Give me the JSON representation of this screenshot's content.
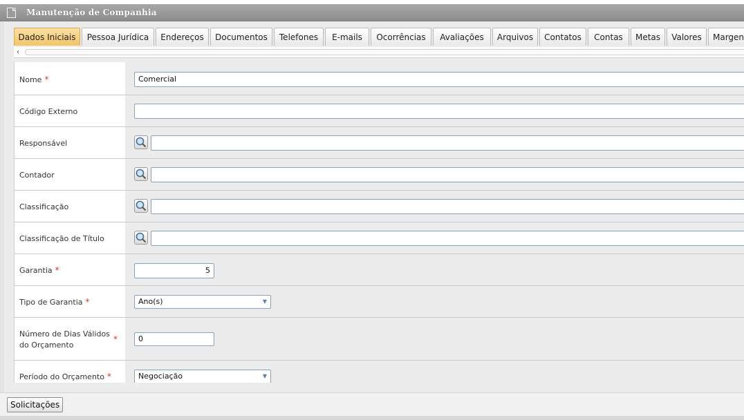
{
  "window": {
    "title": "Manutenção de Companhia"
  },
  "tabs": [
    {
      "label": "Dados Iniciais",
      "active": true
    },
    {
      "label": "Pessoa Jurídica",
      "active": false
    },
    {
      "label": "Endereços",
      "active": false
    },
    {
      "label": "Documentos",
      "active": false
    },
    {
      "label": "Telefones",
      "active": false
    },
    {
      "label": "E-mails",
      "active": false
    },
    {
      "label": "Ocorrências",
      "active": false
    },
    {
      "label": "Avaliações",
      "active": false
    },
    {
      "label": "Arquivos",
      "active": false
    },
    {
      "label": "Contatos",
      "active": false
    },
    {
      "label": "Contas",
      "active": false
    },
    {
      "label": "Metas",
      "active": false
    },
    {
      "label": "Valores",
      "active": false
    },
    {
      "label": "Margen",
      "active": false
    }
  ],
  "scroll": {
    "left_arrow": "‹"
  },
  "form": {
    "required_mark": "*",
    "nome": {
      "label": "Nome",
      "value": "Comercial"
    },
    "codigo_externo": {
      "label": "Código Externo",
      "value": ""
    },
    "responsavel": {
      "label": "Responsável",
      "value": ""
    },
    "contador": {
      "label": "Contador",
      "value": ""
    },
    "classificacao": {
      "label": "Classificação",
      "value": ""
    },
    "classificacao_titulo": {
      "label": "Classificação de Título",
      "value": ""
    },
    "garantia": {
      "label": "Garantia",
      "value": "5"
    },
    "tipo_garantia": {
      "label": "Tipo de Garantia",
      "value": "Ano(s)"
    },
    "dias_validos": {
      "label_line1": "Número de Dias Válidos",
      "label_line2": "do Orçamento",
      "value": "0"
    },
    "periodo_orcamento": {
      "label": "Período do Orçamento",
      "value": "Negociação"
    }
  },
  "footer": {
    "solicitacoes_label": "Solicitações"
  },
  "colors": {
    "active_tab": "#f4c566",
    "required": "#d9322b",
    "input_border": "#8aa0b8"
  },
  "icons": {
    "lookup": "magnifier-icon",
    "select": "chevron-down-icon",
    "window": "document-icon"
  }
}
